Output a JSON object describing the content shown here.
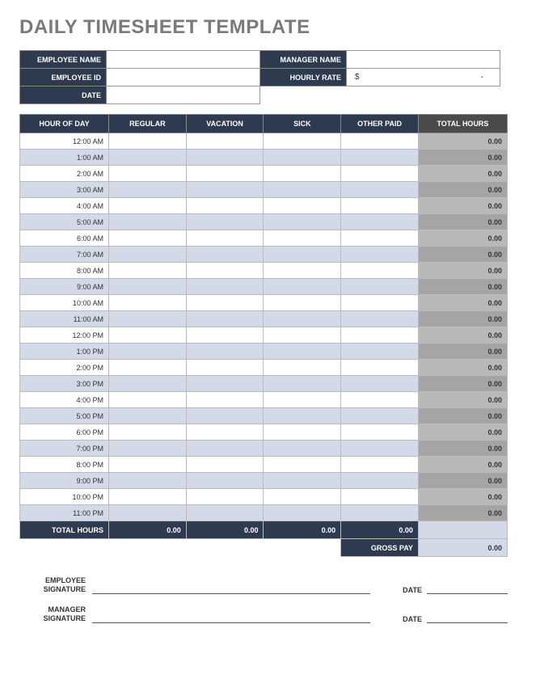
{
  "title": "DAILY TIMESHEET TEMPLATE",
  "info": {
    "employee_name_label": "EMPLOYEE NAME",
    "employee_name": "",
    "manager_name_label": "MANAGER NAME",
    "manager_name": "",
    "employee_id_label": "EMPLOYEE ID",
    "employee_id": "",
    "hourly_rate_label": "HOURLY RATE",
    "hourly_rate": "$            -",
    "date_label": "DATE",
    "date": ""
  },
  "columns": {
    "hour": "HOUR OF DAY",
    "regular": "REGULAR",
    "vacation": "VACATION",
    "sick": "SICK",
    "other": "OTHER PAID",
    "total": "TOTAL HOURS"
  },
  "hours": [
    {
      "h": "12:00 AM",
      "r": "",
      "v": "",
      "s": "",
      "o": "",
      "t": "0.00"
    },
    {
      "h": "1:00 AM",
      "r": "",
      "v": "",
      "s": "",
      "o": "",
      "t": "0.00"
    },
    {
      "h": "2:00 AM",
      "r": "",
      "v": "",
      "s": "",
      "o": "",
      "t": "0.00"
    },
    {
      "h": "3:00 AM",
      "r": "",
      "v": "",
      "s": "",
      "o": "",
      "t": "0.00"
    },
    {
      "h": "4:00 AM",
      "r": "",
      "v": "",
      "s": "",
      "o": "",
      "t": "0.00"
    },
    {
      "h": "5:00 AM",
      "r": "",
      "v": "",
      "s": "",
      "o": "",
      "t": "0.00"
    },
    {
      "h": "6:00 AM",
      "r": "",
      "v": "",
      "s": "",
      "o": "",
      "t": "0.00"
    },
    {
      "h": "7:00 AM",
      "r": "",
      "v": "",
      "s": "",
      "o": "",
      "t": "0.00"
    },
    {
      "h": "8:00 AM",
      "r": "",
      "v": "",
      "s": "",
      "o": "",
      "t": "0.00"
    },
    {
      "h": "9:00 AM",
      "r": "",
      "v": "",
      "s": "",
      "o": "",
      "t": "0.00"
    },
    {
      "h": "10:00 AM",
      "r": "",
      "v": "",
      "s": "",
      "o": "",
      "t": "0.00"
    },
    {
      "h": "11:00 AM",
      "r": "",
      "v": "",
      "s": "",
      "o": "",
      "t": "0.00"
    },
    {
      "h": "12:00 PM",
      "r": "",
      "v": "",
      "s": "",
      "o": "",
      "t": "0.00"
    },
    {
      "h": "1:00 PM",
      "r": "",
      "v": "",
      "s": "",
      "o": "",
      "t": "0.00"
    },
    {
      "h": "2:00 PM",
      "r": "",
      "v": "",
      "s": "",
      "o": "",
      "t": "0.00"
    },
    {
      "h": "3:00 PM",
      "r": "",
      "v": "",
      "s": "",
      "o": "",
      "t": "0.00"
    },
    {
      "h": "4:00 PM",
      "r": "",
      "v": "",
      "s": "",
      "o": "",
      "t": "0.00"
    },
    {
      "h": "5:00 PM",
      "r": "",
      "v": "",
      "s": "",
      "o": "",
      "t": "0.00"
    },
    {
      "h": "6:00 PM",
      "r": "",
      "v": "",
      "s": "",
      "o": "",
      "t": "0.00"
    },
    {
      "h": "7:00 PM",
      "r": "",
      "v": "",
      "s": "",
      "o": "",
      "t": "0.00"
    },
    {
      "h": "8:00 PM",
      "r": "",
      "v": "",
      "s": "",
      "o": "",
      "t": "0.00"
    },
    {
      "h": "9:00 PM",
      "r": "",
      "v": "",
      "s": "",
      "o": "",
      "t": "0.00"
    },
    {
      "h": "10:00 PM",
      "r": "",
      "v": "",
      "s": "",
      "o": "",
      "t": "0.00"
    },
    {
      "h": "11:00 PM",
      "r": "",
      "v": "",
      "s": "",
      "o": "",
      "t": "0.00"
    }
  ],
  "totals": {
    "label": "TOTAL HOURS",
    "regular": "0.00",
    "vacation": "0.00",
    "sick": "0.00",
    "other": "0.00",
    "total": ""
  },
  "gross": {
    "label": "GROSS PAY",
    "value": "0.00"
  },
  "sig": {
    "employee_label": "EMPLOYEE SIGNATURE",
    "manager_label": "MANAGER SIGNATURE",
    "date_label": "DATE"
  }
}
